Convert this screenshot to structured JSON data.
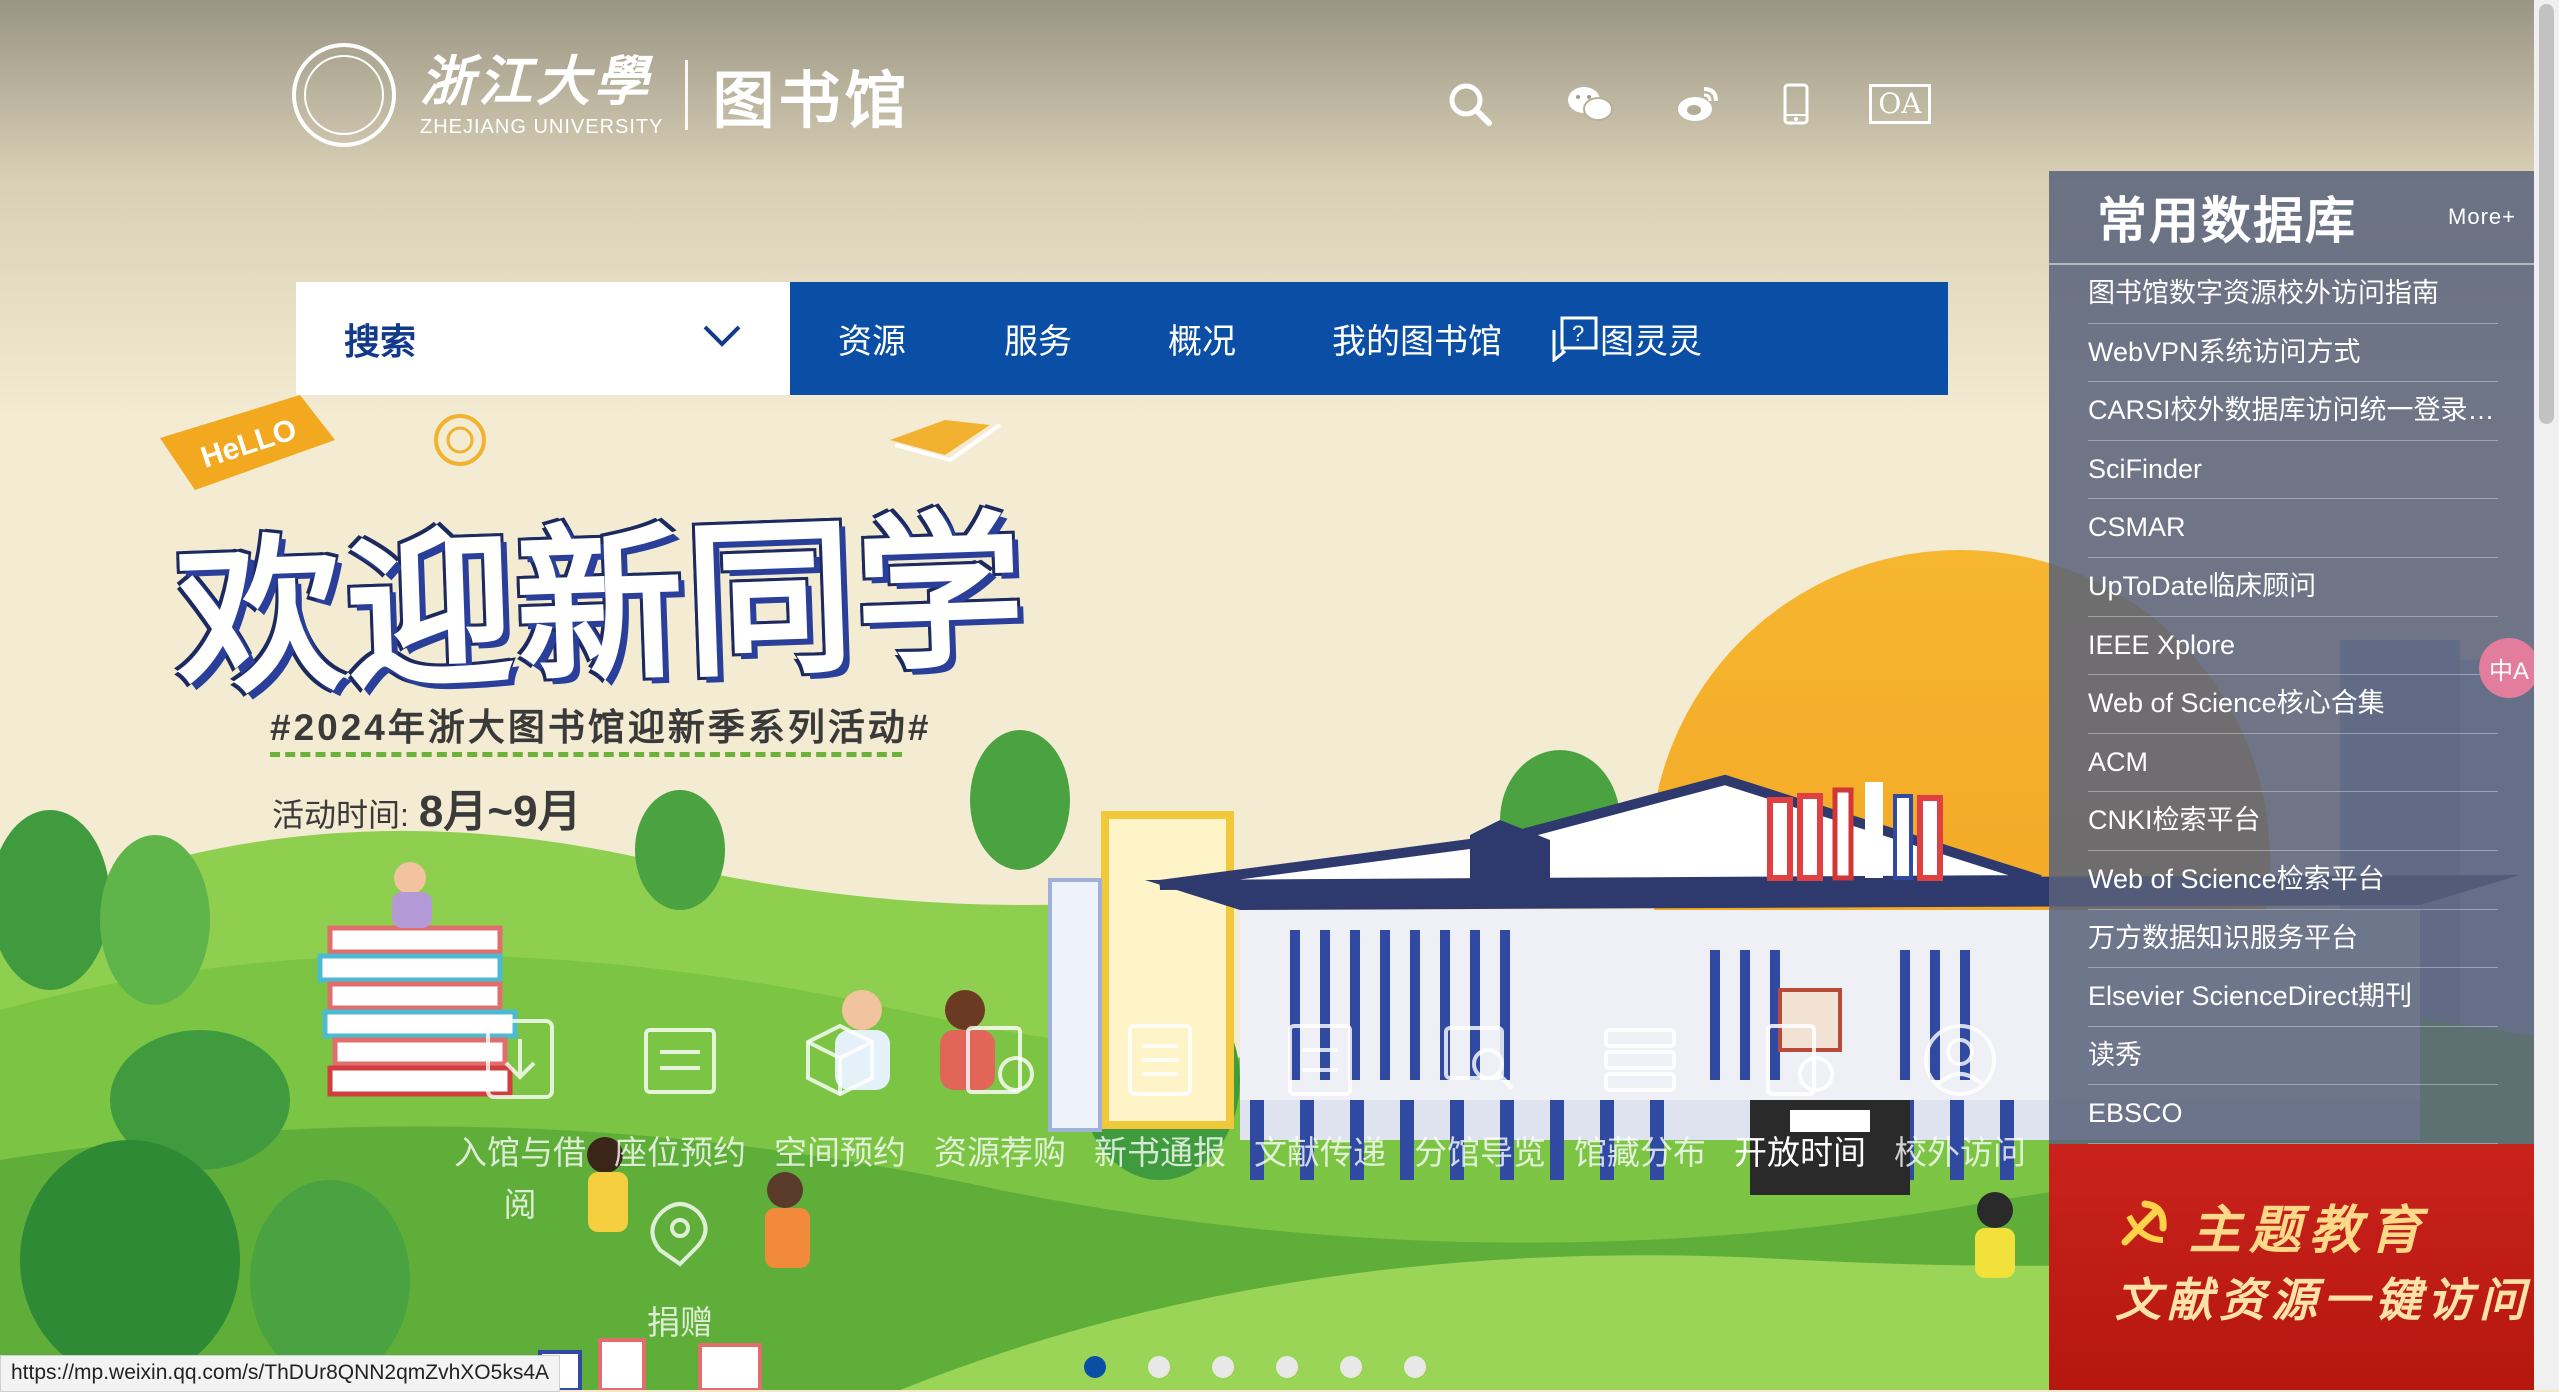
{
  "header": {
    "university_cn": "浙江大學",
    "university_en": "ZHEJIANG UNIVERSITY",
    "library_name": "图书馆",
    "icons": [
      "search-icon",
      "wechat-icon",
      "weibo-icon",
      "mobile-icon",
      "oa-icon"
    ],
    "oa_label": "OA"
  },
  "nav": {
    "search_label": "搜索",
    "items": [
      "资源",
      "服务",
      "概况",
      "我的图书馆",
      "图灵灵"
    ]
  },
  "banner": {
    "hello": "HeLLO",
    "title": "欢迎新同学",
    "hashtag": "#2024年浙大图书馆迎新季系列活动#",
    "period_label": "活动时间:",
    "period_value": "8月~9月"
  },
  "quick_links": [
    {
      "label": "入馆与借阅",
      "icon": "borrow-icon"
    },
    {
      "label": "座位预约",
      "icon": "seat-icon"
    },
    {
      "label": "空间预约",
      "icon": "space-icon"
    },
    {
      "label": "资源荐购",
      "icon": "purchase-icon"
    },
    {
      "label": "新书通报",
      "icon": "newbook-icon"
    },
    {
      "label": "文献传递",
      "icon": "delivery-icon"
    },
    {
      "label": "分馆导览",
      "icon": "guide-icon"
    },
    {
      "label": "馆藏分布",
      "icon": "collection-icon"
    },
    {
      "label": "开放时间",
      "icon": "hours-icon"
    },
    {
      "label": "校外访问",
      "icon": "remote-icon"
    },
    {
      "label": "捐赠",
      "icon": "donate-icon"
    }
  ],
  "databases": {
    "title": "常用数据库",
    "more": "More+",
    "items": [
      "图书馆数字资源校外访问指南",
      "WebVPN系统访问方式",
      "CARSI校外数据库访问统一登录平...",
      "SciFinder",
      "CSMAR",
      "UpToDate临床顾问",
      "IEEE Xplore",
      "Web of Science核心合集",
      "ACM",
      "CNKI检索平台",
      "Web of Science检索平台",
      "万方数据知识服务平台",
      "Elsevier ScienceDirect期刊",
      "读秀",
      "EBSCO"
    ]
  },
  "promo": {
    "line1": "主题教育",
    "line2": "文献资源一键访问"
  },
  "carousel": {
    "count": 6,
    "active": 0
  },
  "status_url": "https://mp.weixin.qq.com/s/ThDUr8QNN2qmZvhXO5ks4A",
  "translate_label": "中A",
  "colors": {
    "nav_blue": "#0a4fa5",
    "panel": "#58627a",
    "promo_red": "#c9221c"
  }
}
